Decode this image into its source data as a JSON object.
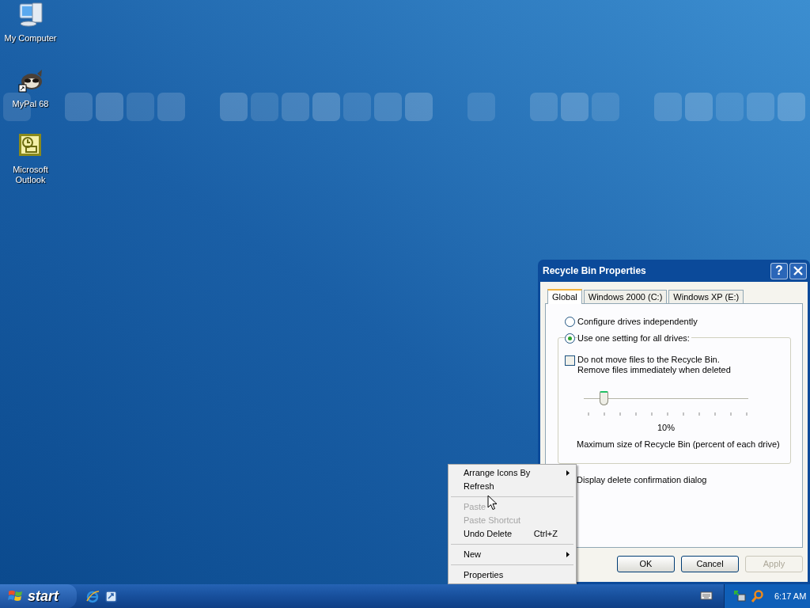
{
  "desktop_icons": [
    {
      "label": "My Computer",
      "kind": "computer"
    },
    {
      "label": "MyPal 68",
      "kind": "raccoon",
      "shortcut": true
    },
    {
      "label": "Microsoft Outlook",
      "kind": "outlook"
    }
  ],
  "dialog": {
    "title": "Recycle Bin Properties",
    "help_button": "?",
    "tabs": [
      {
        "label": "Global",
        "selected": true
      },
      {
        "label": "Windows 2000 (C:)",
        "selected": false
      },
      {
        "label": "Windows XP (E:)",
        "selected": false
      }
    ],
    "radios": [
      {
        "label": "Configure drives independently",
        "selected": false
      },
      {
        "label": "Use one setting for all drives:",
        "selected": true
      }
    ],
    "checkbox": {
      "label": "Do not move files to the Recycle Bin.\nRemove files immediately when deleted",
      "checked": false
    },
    "slider": {
      "level": 0.12,
      "reading": "10%",
      "caption": "Maximum size of Recycle Bin (percent of each drive)"
    },
    "confirmation_label": "Display delete confirmation dialog",
    "buttons": [
      {
        "label": "OK",
        "disabled": false
      },
      {
        "label": "Cancel",
        "disabled": false
      },
      {
        "label": "Apply",
        "disabled": true
      }
    ]
  },
  "context_menu": {
    "items": [
      {
        "kind": "item",
        "label": "Arrange Icons By",
        "submenu": true,
        "disabled": false
      },
      {
        "kind": "item",
        "label": "Refresh",
        "submenu": false,
        "disabled": false
      },
      {
        "kind": "separator"
      },
      {
        "kind": "item",
        "label": "Paste",
        "submenu": false,
        "disabled": true
      },
      {
        "kind": "item",
        "label": "Paste Shortcut",
        "submenu": false,
        "disabled": true
      },
      {
        "kind": "item",
        "label": "Undo Delete",
        "shortcut": "Ctrl+Z",
        "submenu": false,
        "disabled": false
      },
      {
        "kind": "separator"
      },
      {
        "kind": "item",
        "label": "New",
        "submenu": true,
        "disabled": false
      },
      {
        "kind": "separator"
      },
      {
        "kind": "item",
        "label": "Properties",
        "submenu": false,
        "disabled": false
      }
    ]
  },
  "taskbar": {
    "start_label": "start",
    "quick_launch": [
      {
        "kind": "browser"
      },
      {
        "kind": "desktop"
      }
    ],
    "tray": [
      {
        "kind": "keyboard"
      },
      {
        "kind": "network"
      },
      {
        "kind": "search"
      }
    ],
    "clock": "6:17 AM"
  }
}
